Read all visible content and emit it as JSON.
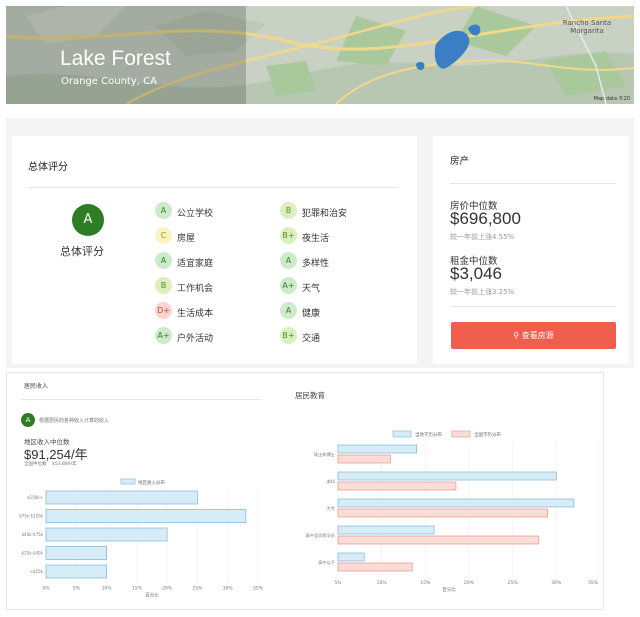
{
  "header": {
    "city": "Lake Forest",
    "county": "Orange County, CA",
    "map_place": "Rancho Santa Margarita",
    "map_data": "Map data ©20",
    "colors": {
      "land": "#c7cfc4",
      "park": "#a9c89b",
      "water": "#3a7fc4",
      "road": "#f0d98a"
    }
  },
  "overall": {
    "title": "总体评分",
    "grade": "A",
    "grade_label": "总体评分",
    "items": [
      {
        "grade": "A",
        "label": "公立学校",
        "tone": "green"
      },
      {
        "grade": "C",
        "label": "房屋",
        "tone": "yellow"
      },
      {
        "grade": "A",
        "label": "适宜家庭",
        "tone": "green"
      },
      {
        "grade": "B",
        "label": "工作机会",
        "tone": "lime"
      },
      {
        "grade": "D+",
        "label": "生活成本",
        "tone": "red"
      },
      {
        "grade": "A+",
        "label": "户外活动",
        "tone": "green"
      },
      {
        "grade": "B",
        "label": "犯罪和治安",
        "tone": "lime"
      },
      {
        "grade": "B+",
        "label": "夜生活",
        "tone": "lime"
      },
      {
        "grade": "A",
        "label": "多样性",
        "tone": "green"
      },
      {
        "grade": "A+",
        "label": "天气",
        "tone": "green"
      },
      {
        "grade": "A",
        "label": "健康",
        "tone": "green"
      },
      {
        "grade": "B+",
        "label": "交通",
        "tone": "lime"
      }
    ]
  },
  "housing": {
    "title": "房产",
    "median_price_label": "房价中位数",
    "median_price": "$696,800",
    "median_price_change": "较一年前上涨4.55%",
    "median_rent_label": "租金中位数",
    "median_rent": "$3,046",
    "median_rent_change": "较一年前上涨3.25%",
    "button_label": "查看房源",
    "button_color": "#f05f4e"
  },
  "income": {
    "title": "居民收入",
    "grade": "A",
    "grade_note": "根据居民的各种收入计算的收入",
    "median_label": "地区收入中位数",
    "median_value": "$91,254/年",
    "national_label": "全国中位数",
    "national_value": "$53,889/年",
    "legend": "地区收入分布",
    "x_axis_label": "百分比"
  },
  "education": {
    "title": "居民教育",
    "legend_local": "当地学历分布",
    "legend_national": "全国学历分布",
    "x_axis_label": "百分比"
  },
  "chart_data": [
    {
      "type": "bar",
      "orientation": "horizontal",
      "categories": [
        "$150k+",
        "$75k-$150k",
        "$45k-$75k",
        "$25k-$45k",
        "<$25k"
      ],
      "series": [
        {
          "name": "地区收入分布",
          "values": [
            25,
            33,
            20,
            10,
            10
          ]
        }
      ],
      "xlim": [
        0,
        35
      ],
      "xticks": [
        "0%",
        "5%",
        "10%",
        "15%",
        "20%",
        "25%",
        "30%",
        "35%"
      ],
      "xlabel": "百分比",
      "colors": [
        "#d6ecf7"
      ]
    },
    {
      "type": "bar",
      "orientation": "horizontal",
      "categories": [
        "硕士和博士",
        "本科",
        "大专",
        "高中及同等学历",
        "高中以下"
      ],
      "series": [
        {
          "name": "当地学历分布",
          "values": [
            14,
            30,
            32,
            16,
            8
          ]
        },
        {
          "name": "全国学历分布",
          "values": [
            11,
            18.5,
            29,
            28,
            13.5
          ]
        }
      ],
      "xlim": [
        5,
        35
      ],
      "xticks": [
        "5%",
        "10%",
        "15%",
        "20%",
        "25%",
        "30%",
        "35%"
      ],
      "xlabel": "百分比",
      "colors": [
        "#d6ecf7",
        "#fbdcd6"
      ]
    }
  ]
}
